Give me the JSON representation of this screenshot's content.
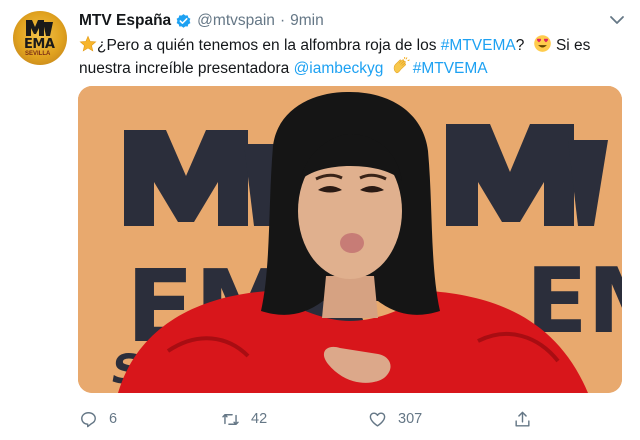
{
  "tweet": {
    "author": {
      "name": "MTV España",
      "handle": "@mtvspain",
      "separator": "·",
      "time": "9min",
      "avatar_icon": "mtv-ema-sevilla-logo",
      "avatar_text": "EMA",
      "avatar_subtext": "SEVILLA"
    },
    "text": {
      "line1_prefix": "¿Pero a quién tenemos en la alfombra roja de los ",
      "hashtag1": "#MTVEMA",
      "line1_after_hashtag": "?",
      "line1_suffix": " Si es",
      "line2_prefix": "nuestra increíble presentadora ",
      "mention": "@iambeckyg",
      "hashtag2": "#MTVEMA",
      "emoji_star": "star-emoji",
      "emoji_heart_eyes": "heart-eyes-emoji",
      "emoji_clap": "clapping-hands-emoji"
    },
    "media": {
      "backdrop_text_top": "MTV",
      "backdrop_text_bottom": "EMA",
      "backdrop_text_corner": "SE",
      "colors": {
        "backdrop": "#e8a96e",
        "logo": "#2a2d3a",
        "dress": "#d8161b",
        "hair": "#151515",
        "skin": "#e0b08e"
      }
    },
    "actions": {
      "reply_count": "6",
      "retweet_count": "42",
      "like_count": "307",
      "reply_icon": "reply-icon",
      "retweet_icon": "retweet-icon",
      "like_icon": "heart-icon",
      "share_icon": "share-icon"
    },
    "colors": {
      "link": "#1da1f2",
      "muted": "#657786",
      "text": "#14171a",
      "verified": "#1da1f2"
    }
  }
}
